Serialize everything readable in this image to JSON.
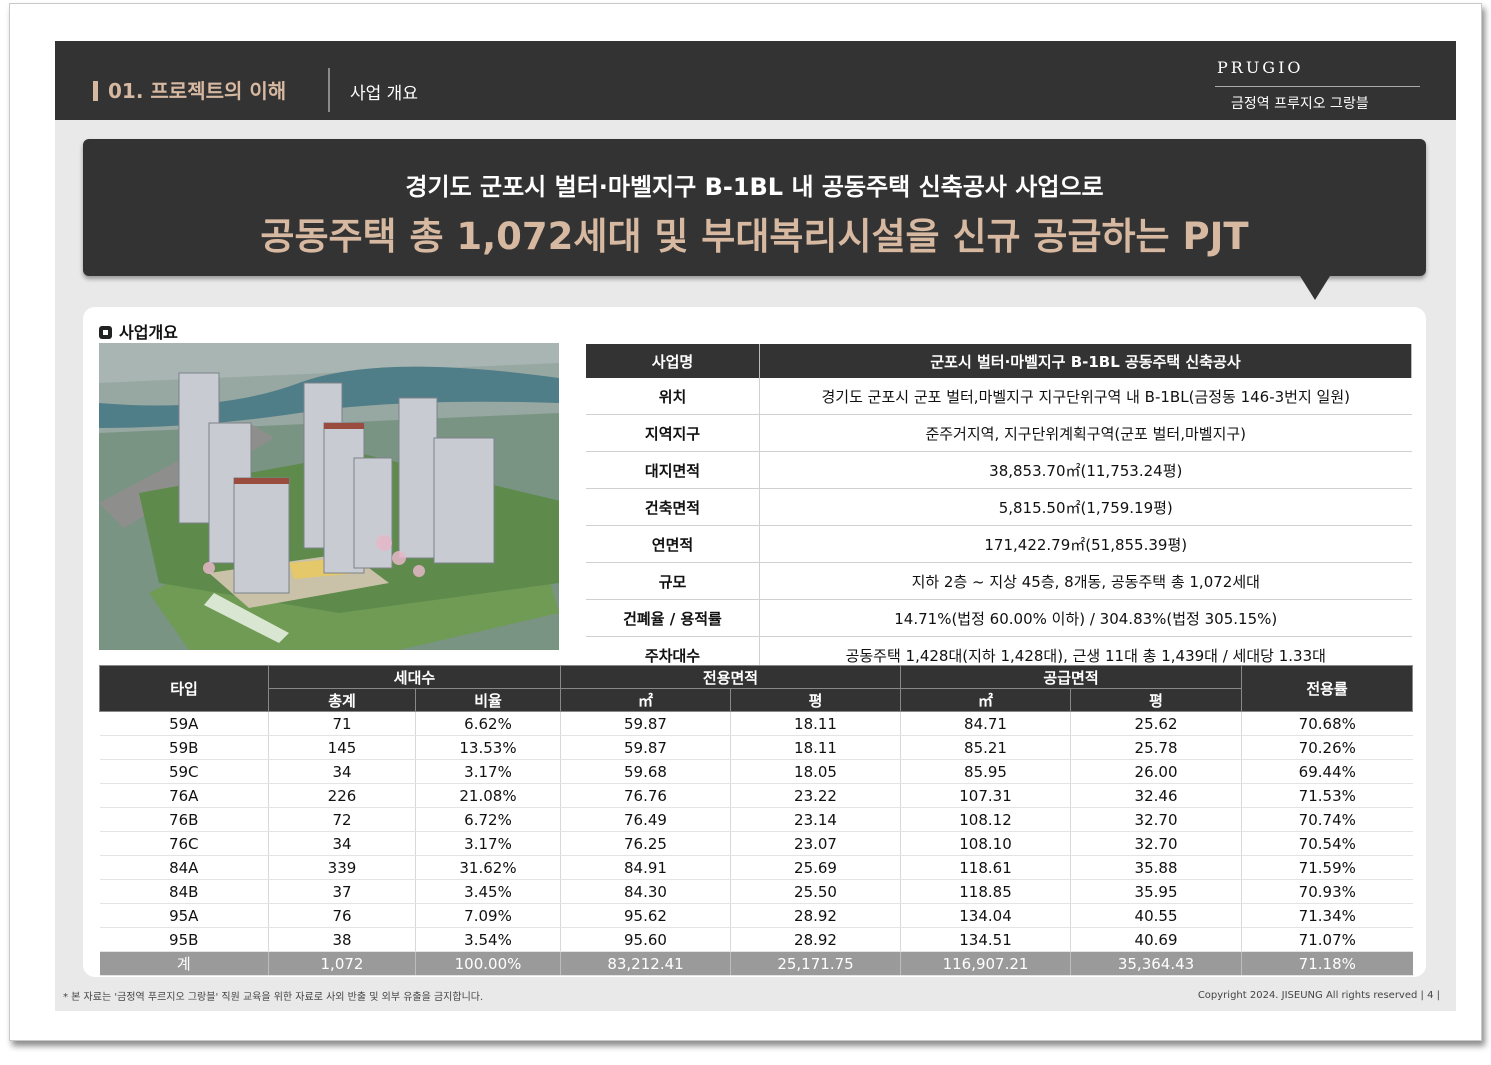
{
  "header": {
    "section_label": "01. 프로젝트의 이해",
    "subtitle": "사업 개요",
    "logo_line1": "PRUGIO",
    "logo_line2": "금정역 프루지오 그랑블"
  },
  "headline": {
    "line1": "경기도 군포시 벌터·마벨지구 B-1BL 내 공동주택 신축공사 사업으로",
    "line2": "공동주택 총 1,072세대 및 부대복리시설을 신규 공급하는 PJT"
  },
  "overview": {
    "title": "사업개요",
    "header_key": "사업명",
    "header_value": "군포시 벌터·마벨지구 B-1BL 공동주택 신축공사",
    "rows": [
      {
        "key": "위치",
        "value": "경기도 군포시 군포 벌터,마벨지구 지구단위구역 내 B-1BL(금정동 146-3번지 일원)"
      },
      {
        "key": "지역지구",
        "value": "준주거지역, 지구단위계획구역(군포 벌터,마벨지구)"
      },
      {
        "key": "대지면적",
        "value": "38,853.70㎡(11,753.24평)"
      },
      {
        "key": "건축면적",
        "value": "5,815.50㎡(1,759.19평)"
      },
      {
        "key": "연면적",
        "value": "171,422.79㎡(51,855.39평)"
      },
      {
        "key": "규모",
        "value": "지하 2층 ~ 지상 45층, 8개동, 공동주택 총 1,072세대"
      },
      {
        "key": "건폐율 / 용적률",
        "value": "14.71%(법정 60.00% 이하) / 304.83%(법정 305.15%)"
      },
      {
        "key": "주차대수",
        "value": "공동주택 1,428대(지하 1,428대), 근생 11대 총 1,439대 / 세대당 1.33대"
      }
    ]
  },
  "unit_table": {
    "headers": {
      "type": "타입",
      "households": "세대수",
      "exclusive_area": "전용면적",
      "supply_area": "공급면적",
      "ratio": "전용률",
      "total": "총계",
      "share": "비율",
      "sqm": "㎡",
      "pyeong": "평"
    },
    "rows": [
      [
        "59A",
        "71",
        "6.62%",
        "59.87",
        "18.11",
        "84.71",
        "25.62",
        "70.68%"
      ],
      [
        "59B",
        "145",
        "13.53%",
        "59.87",
        "18.11",
        "85.21",
        "25.78",
        "70.26%"
      ],
      [
        "59C",
        "34",
        "3.17%",
        "59.68",
        "18.05",
        "85.95",
        "26.00",
        "69.44%"
      ],
      [
        "76A",
        "226",
        "21.08%",
        "76.76",
        "23.22",
        "107.31",
        "32.46",
        "71.53%"
      ],
      [
        "76B",
        "72",
        "6.72%",
        "76.49",
        "23.14",
        "108.12",
        "32.70",
        "70.74%"
      ],
      [
        "76C",
        "34",
        "3.17%",
        "76.25",
        "23.07",
        "108.10",
        "32.70",
        "70.54%"
      ],
      [
        "84A",
        "339",
        "31.62%",
        "84.91",
        "25.69",
        "118.61",
        "35.88",
        "71.59%"
      ],
      [
        "84B",
        "37",
        "3.45%",
        "84.30",
        "25.50",
        "118.85",
        "35.95",
        "70.93%"
      ],
      [
        "95A",
        "76",
        "7.09%",
        "95.62",
        "28.92",
        "134.04",
        "40.55",
        "71.34%"
      ],
      [
        "95B",
        "38",
        "3.54%",
        "95.60",
        "28.92",
        "134.51",
        "40.69",
        "71.07%"
      ]
    ],
    "total": [
      "계",
      "1,072",
      "100.00%",
      "83,212.41",
      "25,171.75",
      "116,907.21",
      "35,364.43",
      "71.18%"
    ]
  },
  "footer": {
    "note": "* 본 자료는 '금정역 푸르지오 그랑블' 직원 교육을 위한 자료로 사외 반출 및 외부 유출을 금지합니다.",
    "copyright": "Copyright 2024. JISEUNG All rights reserved  | 4 |"
  }
}
